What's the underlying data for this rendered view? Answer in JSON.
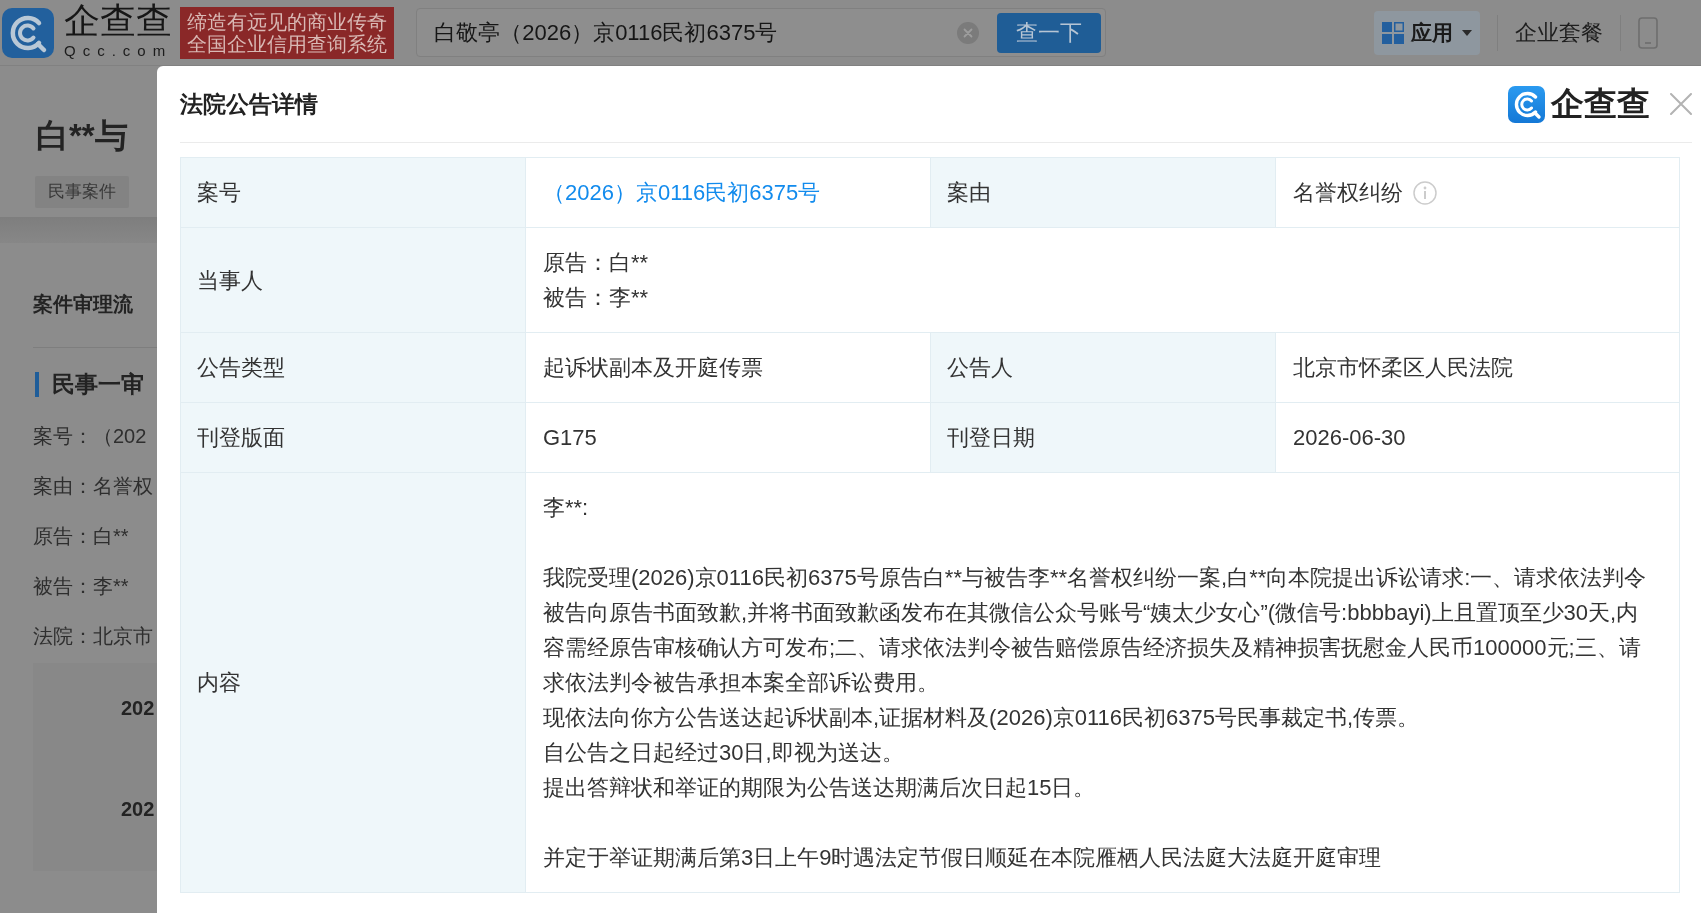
{
  "top_bar": {
    "logo": {
      "name": "企查查",
      "domain": "Qcc.com"
    },
    "slogan": [
      "缔造有远见的商业传奇",
      "全国企业信用查询系统"
    ],
    "search": {
      "value": "白敬亭（2026）京0116民初6375号",
      "button": "查一下"
    },
    "nav": [
      {
        "label": "应用",
        "kind": "menu"
      },
      {
        "label": "企业套餐",
        "kind": "link"
      }
    ]
  },
  "background_page": {
    "title": "白**与",
    "tags": [
      "民事案件"
    ],
    "section_title": "案件审理流",
    "stage": {
      "title": "民事一审",
      "fields": [
        "案号：（202",
        "案由：名誉权",
        "原告：白**",
        "被告：李**",
        "法院：北京市"
      ]
    },
    "timeline": [
      "202",
      "202"
    ]
  },
  "dialog": {
    "title": "法院公告详情",
    "brand": "企查查",
    "rows": [
      {
        "fields": [
          {
            "label": "案号",
            "kind": "link",
            "value": "（2026）京0116民初6375号"
          },
          {
            "label": "案由",
            "kind": "text_info",
            "value": "名誉权纠纷"
          }
        ]
      },
      {
        "fields": [
          {
            "label": "当事人",
            "kind": "lines",
            "lines": [
              "原告：白**",
              "被告：李**"
            ]
          }
        ]
      },
      {
        "fields": [
          {
            "label": "公告类型",
            "kind": "text",
            "value": "起诉状副本及开庭传票"
          },
          {
            "label": "公告人",
            "kind": "text",
            "value": "北京市怀柔区人民法院"
          }
        ]
      },
      {
        "fields": [
          {
            "label": "刊登版面",
            "kind": "text",
            "value": "G175"
          },
          {
            "label": "刊登日期",
            "kind": "text",
            "value": "2026-06-30"
          }
        ]
      },
      {
        "fields": [
          {
            "label": "内容",
            "kind": "notice",
            "salutation": "李**:",
            "paragraphs": [
              "我院受理(2026)京0116民初6375号原告白**与被告李**名誉权纠纷一案,白**向本院提出诉讼请求:一、请求依法判令被告向原告书面致歉,并将书面致歉函发布在其微信公众号账号“姨太少女心”(微信号:bbbbayi)上且置顶至少30天,内容需经原告审核确认方可发布;二、请求依法判令被告赔偿原告经济损失及精神损害抚慰金人民币100000元;三、请求依法判令被告承担本案全部诉讼费用。",
              "现依法向你方公告送达起诉状副本,证据材料及(2026)京0116民初6375号民事裁定书,传票。",
              "自公告之日起经过30日,即视为送达。",
              "提出答辩状和举证的期限为公告送达期满后次日起15日。"
            ],
            "closing": "并定于举证期满后第3日上午9时遇法定节假日顺延在本院雁栖人民法庭大法庭开庭审理"
          }
        ]
      }
    ]
  }
}
